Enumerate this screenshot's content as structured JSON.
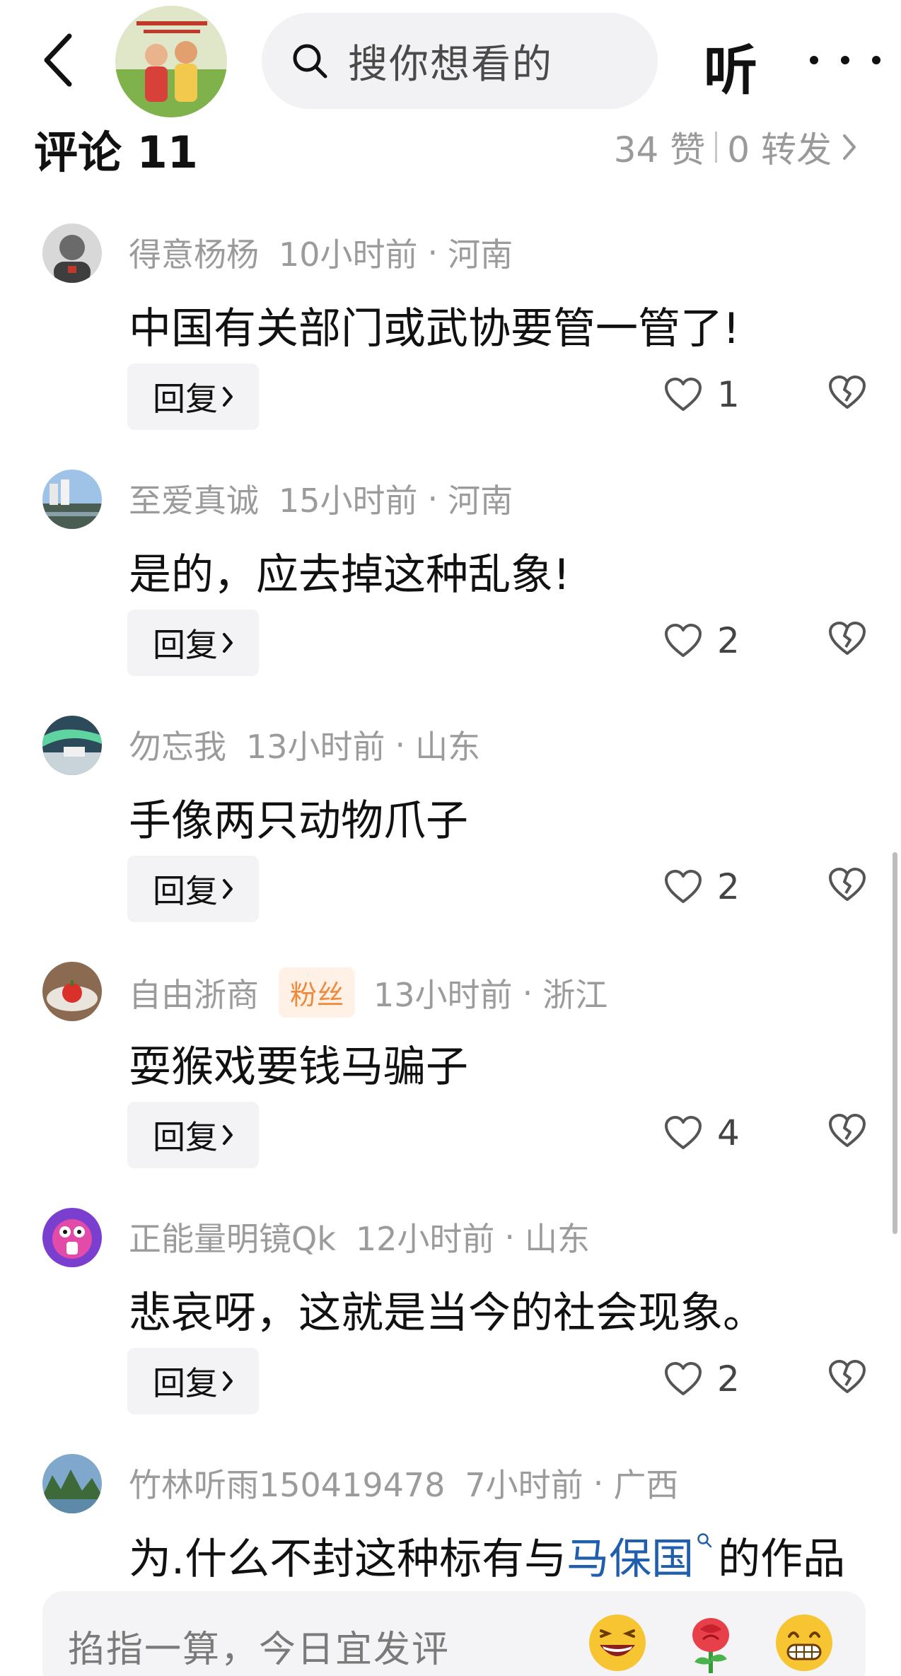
{
  "header": {
    "search_placeholder": "搜你想看的",
    "listen_label": "听",
    "comments_label": "评论 11",
    "likes": "34 赞",
    "reposts": "0 转发"
  },
  "comments": [
    {
      "name": "得意杨杨",
      "badge": "",
      "time": "10小时前",
      "region": "河南",
      "text": "中国有关部门或武协要管一管了!",
      "likes": "1"
    },
    {
      "name": "至爱真诚",
      "badge": "",
      "time": "15小时前",
      "region": "河南",
      "text": "是的，应去掉这种乱象!",
      "likes": "2"
    },
    {
      "name": "勿忘我",
      "badge": "",
      "time": "13小时前",
      "region": "山东",
      "text": "手像两只动物爪子",
      "likes": "2"
    },
    {
      "name": "自由浙商",
      "badge": "粉丝",
      "time": "13小时前",
      "region": "浙江",
      "text": "耍猴戏要钱马骗子",
      "likes": "4"
    },
    {
      "name": "正能量明镜Qk",
      "badge": "",
      "time": "12小时前",
      "region": "山东",
      "text": "悲哀呀，这就是当今的社会现象。",
      "likes": "2"
    },
    {
      "name": "竹林听雨150419478",
      "badge": "",
      "time": "7小时前",
      "region": "广西",
      "text_before": "为.什么不封这种标有与",
      "text_link": "马保国",
      "text_after": "的作品",
      "likes": ""
    }
  ],
  "reply_label": "回复",
  "bottom": {
    "placeholder": "掐指一算，今日宜发评",
    "emojis": [
      "laughing-emoji",
      "rose-emoji",
      "grin-emoji"
    ]
  },
  "colors": {
    "link": "#1f5fae",
    "badge_text": "#f08a3a",
    "badge_bg": "#fff1e6",
    "meta_gray": "#9b9b9b"
  }
}
